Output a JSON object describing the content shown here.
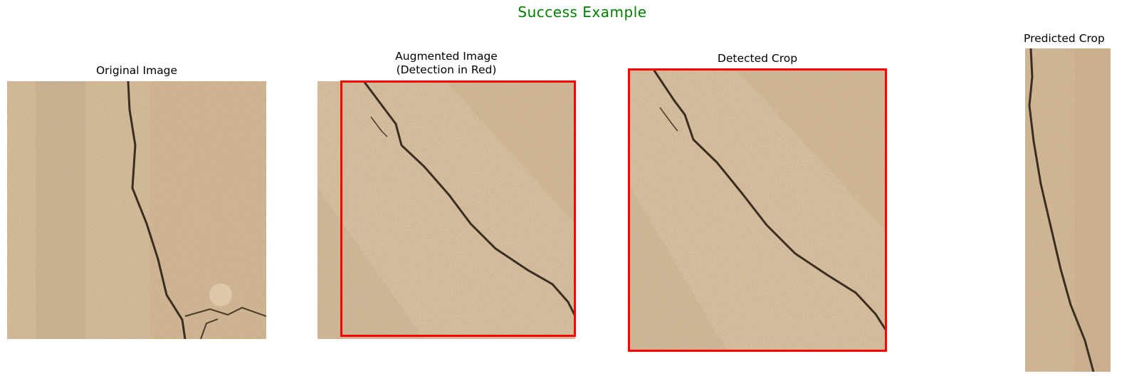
{
  "figure": {
    "suptitle": "Success Example",
    "suptitle_color": "#008000",
    "detection_color": "#ff0000"
  },
  "panels": [
    {
      "title": "Original Image"
    },
    {
      "title": "Augmented Image\n(Detection in Red)"
    },
    {
      "title": "Detected Crop"
    },
    {
      "title": "Predicted Crop"
    }
  ]
}
